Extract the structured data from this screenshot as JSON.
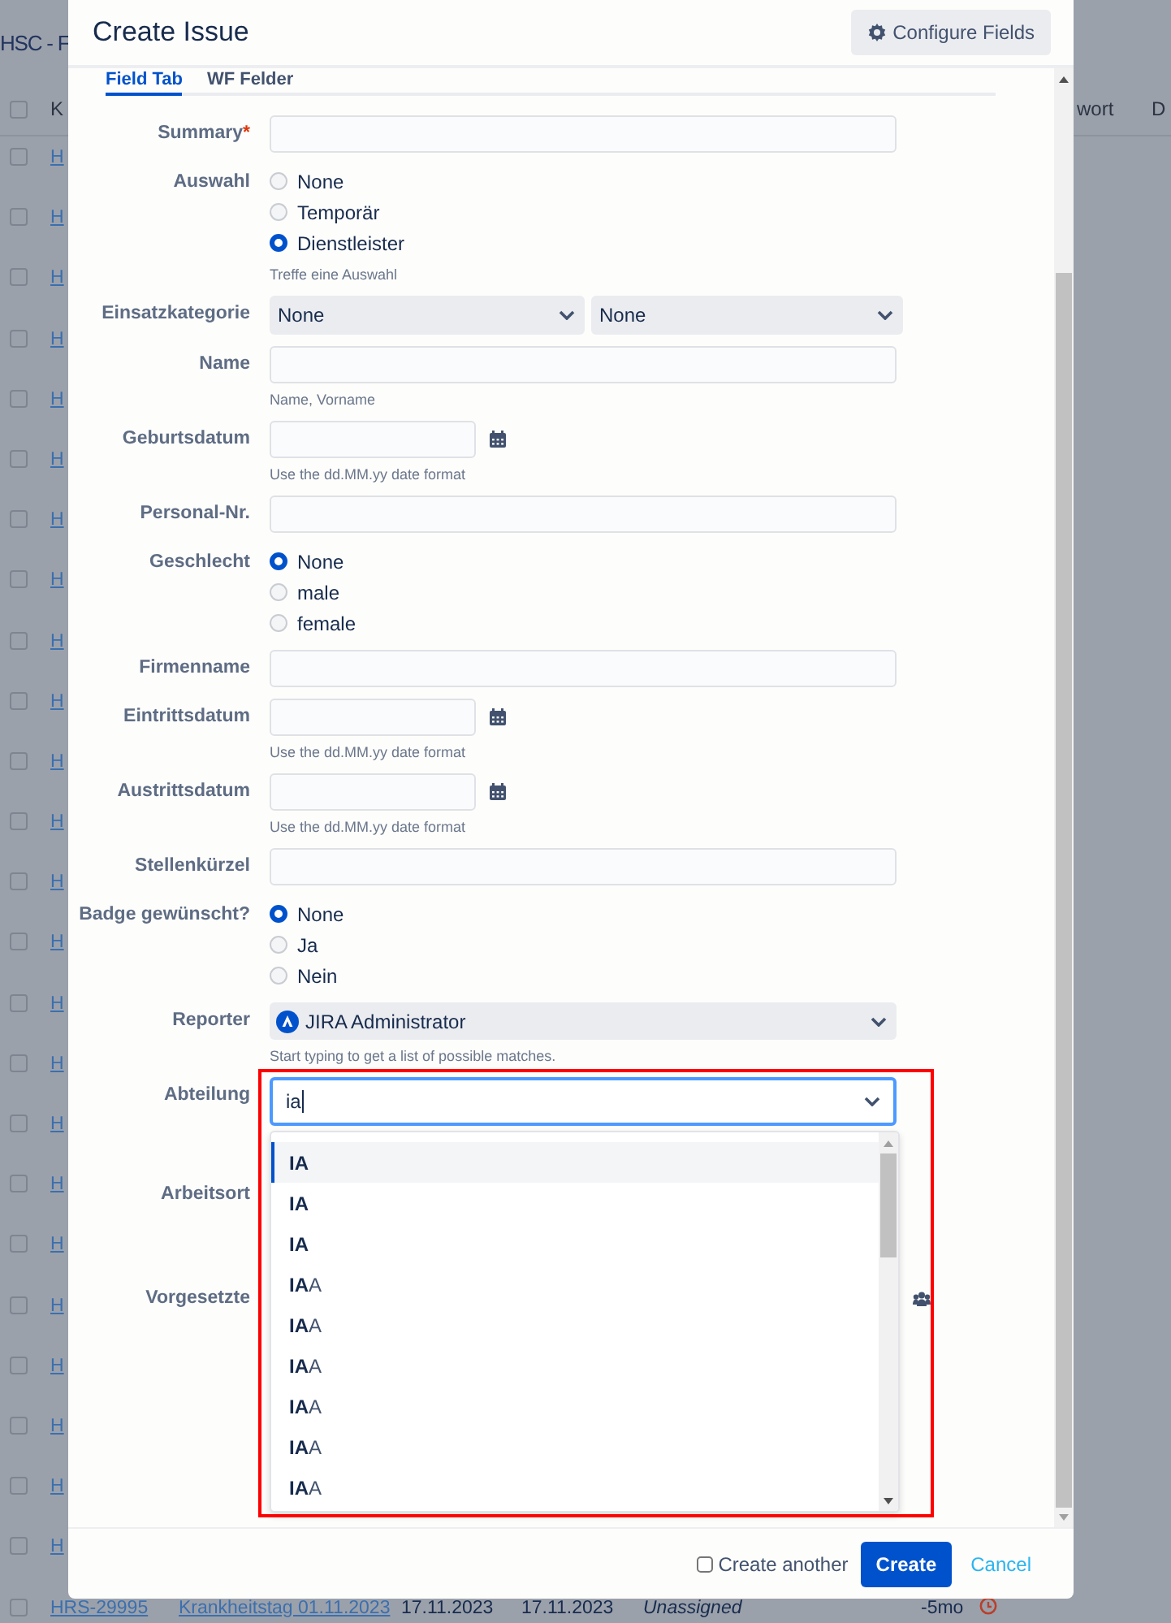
{
  "background_page": {
    "title": "HSC - F",
    "header": {
      "checked": false,
      "column_1": "K",
      "column_2": "wort",
      "column_3": "D"
    },
    "rows": [
      {
        "checked": false,
        "cells": [
          "H"
        ]
      },
      {
        "checked": false,
        "cells": [
          "H"
        ]
      },
      {
        "checked": false,
        "cells": [
          "H"
        ]
      },
      {
        "checked": false,
        "cells": [
          "H"
        ]
      },
      {
        "checked": false,
        "cells": [
          "H"
        ]
      },
      {
        "checked": false,
        "cells": [
          "H"
        ]
      },
      {
        "checked": false,
        "cells": [
          "H"
        ]
      },
      {
        "checked": false,
        "cells": [
          "H"
        ]
      },
      {
        "checked": false,
        "cells": [
          "H"
        ]
      },
      {
        "checked": false,
        "cells": [
          "H"
        ]
      },
      {
        "checked": false,
        "cells": [
          "H"
        ]
      },
      {
        "checked": false,
        "cells": [
          "H"
        ]
      },
      {
        "checked": false,
        "cells": [
          "H"
        ]
      },
      {
        "checked": false,
        "cells": [
          "H"
        ]
      },
      {
        "checked": false,
        "cells": [
          "H"
        ]
      },
      {
        "checked": false,
        "cells": [
          "H"
        ]
      },
      {
        "checked": false,
        "cells": [
          "H"
        ]
      },
      {
        "checked": false,
        "cells": [
          "H"
        ]
      },
      {
        "checked": false,
        "cells": [
          "H"
        ]
      },
      {
        "checked": false,
        "cells": [
          "H"
        ]
      },
      {
        "checked": false,
        "cells": [
          "H"
        ]
      },
      {
        "checked": false,
        "cells": [
          "H"
        ]
      },
      {
        "checked": false,
        "cells": [
          "H"
        ]
      },
      {
        "checked": false,
        "cells": [
          "H"
        ]
      },
      {
        "checked": false,
        "cells": [
          "HRS-29995",
          "Krankheitstag 01.11.2023",
          "17.11.2023",
          "17.11.2023",
          "Unassigned",
          "-5mo"
        ]
      }
    ]
  },
  "modal": {
    "title": "Create Issue",
    "configure_button": "Configure Fields",
    "tabs": [
      {
        "label": "Field Tab",
        "selected": true
      },
      {
        "label": "WF Felder",
        "selected": false
      }
    ],
    "fields": [
      {
        "kind": "text",
        "label": "Summary",
        "required_mark": "*"
      },
      {
        "kind": "radio",
        "label": "Auswahl",
        "options": [
          {
            "label": "None",
            "selected": false
          },
          {
            "label": "Temporär",
            "selected": false
          },
          {
            "label": "Dienstleister",
            "selected": true
          }
        ],
        "hint": "Treffe eine Auswahl"
      },
      {
        "kind": "cascade",
        "label": "Einsatzkategorie",
        "values": [
          "None",
          "None"
        ]
      },
      {
        "kind": "text",
        "label": "Name",
        "hint": "Name, Vorname"
      },
      {
        "kind": "date",
        "label": "Geburtsdatum",
        "hint": "Use the dd.MM.yy date format"
      },
      {
        "kind": "text",
        "label": "Personal-Nr."
      },
      {
        "kind": "radio",
        "label": "Geschlecht",
        "options": [
          {
            "label": "None",
            "selected": true
          },
          {
            "label": "male",
            "selected": false
          },
          {
            "label": "female",
            "selected": false
          }
        ]
      },
      {
        "kind": "text",
        "label": "Firmenname"
      },
      {
        "kind": "date",
        "label": "Eintrittsdatum",
        "hint": "Use the dd.MM.yy date format"
      },
      {
        "kind": "date",
        "label": "Austrittsdatum",
        "hint": "Use the dd.MM.yy date format"
      },
      {
        "kind": "text",
        "label": "Stellenkürzel"
      },
      {
        "kind": "radio",
        "label": "Badge gewünscht?",
        "options": [
          {
            "label": "None",
            "selected": true
          },
          {
            "label": "Ja",
            "selected": false
          },
          {
            "label": "Nein",
            "selected": false
          }
        ]
      },
      {
        "kind": "user",
        "label": "Reporter",
        "value": "JIRA Administrator",
        "hint": "Start typing to get a list of possible matches."
      },
      {
        "kind": "autocomplete",
        "label": "Abteilung",
        "value": "ia",
        "suggestions": [
          {
            "label": "**IA**",
            "selected": true
          },
          {
            "label": "**IA**",
            "selected": false
          },
          {
            "label": "**IA**",
            "selected": false
          },
          {
            "label": "**IA**A",
            "selected": false
          },
          {
            "label": "**IA**A",
            "selected": false
          },
          {
            "label": "**IA**A",
            "selected": false
          },
          {
            "label": "**IA**A",
            "selected": false
          },
          {
            "label": "**IA**A",
            "selected": false
          },
          {
            "label": "**IA**A",
            "selected": false
          }
        ]
      },
      {
        "kind": "covered",
        "label": "Arbeitsort"
      },
      {
        "kind": "covered-picker",
        "label": "Vorgesetzte"
      }
    ],
    "footer": {
      "create_another": {
        "label": "Create another",
        "checked": false
      },
      "create_button": "Create",
      "cancel_link": "Cancel"
    }
  }
}
